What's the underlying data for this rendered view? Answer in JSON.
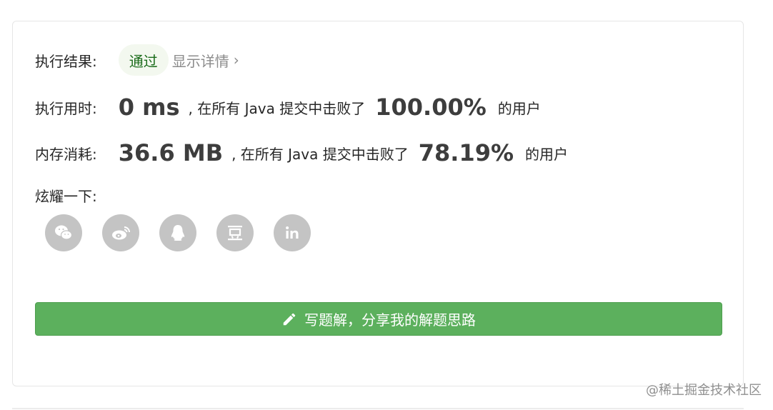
{
  "result": {
    "label": "执行结果:",
    "status": "通过",
    "detail_link": "显示详情",
    "chevron": "›"
  },
  "runtime": {
    "label": "执行用时:",
    "value": "0 ms",
    "text": ", 在所有 Java 提交中击败了",
    "percent": "100.00%",
    "suffix": "的用户"
  },
  "memory": {
    "label": "内存消耗:",
    "value": "36.6 MB",
    "text": ", 在所有 Java 提交中击败了",
    "percent": "78.19%",
    "suffix": "的用户"
  },
  "share": {
    "label": "炫耀一下:",
    "icons": [
      "wechat-icon",
      "weibo-icon",
      "qq-icon",
      "douban-icon",
      "linkedin-icon"
    ]
  },
  "write_solution": {
    "label": "写题解，分享我的解题思路"
  },
  "watermark": "@稀土掘金技术社区",
  "colors": {
    "button_green": "#5cb05d",
    "badge_bg": "#f3f8ef",
    "badge_text": "#1a6b1a",
    "icon_gray": "#c4c4c4"
  }
}
